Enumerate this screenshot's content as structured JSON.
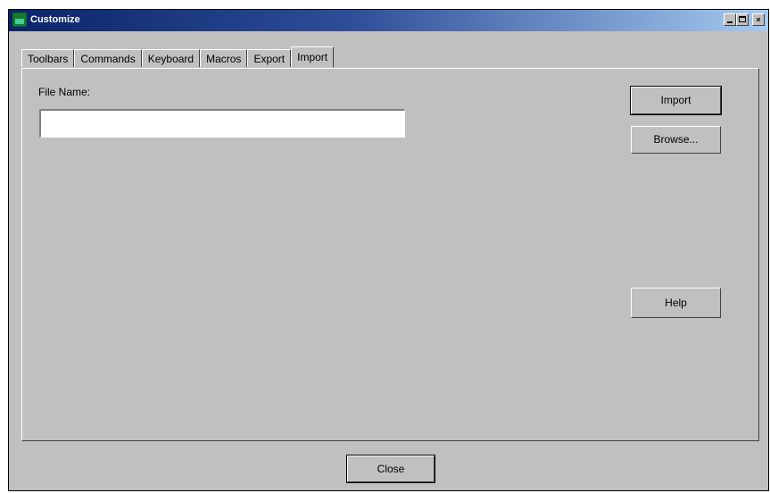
{
  "window": {
    "title": "Customize",
    "close_glyph": "×",
    "minimize_icon": "minimize-icon",
    "maximize_icon": "maximize-icon",
    "close_icon": "close-icon"
  },
  "tabs": [
    {
      "label": "Toolbars",
      "active": false
    },
    {
      "label": "Commands",
      "active": false
    },
    {
      "label": "Keyboard",
      "active": false
    },
    {
      "label": "Macros",
      "active": false
    },
    {
      "label": "Export",
      "active": false
    },
    {
      "label": "Import",
      "active": true
    }
  ],
  "import_panel": {
    "file_name_label": "File Name:",
    "file_name_value": ""
  },
  "buttons": {
    "import": "Import",
    "browse": "Browse...",
    "help": "Help",
    "close": "Close"
  },
  "colors": {
    "face": "#c0c0c0",
    "title_start": "#0a246a",
    "title_end": "#a6caf0"
  }
}
